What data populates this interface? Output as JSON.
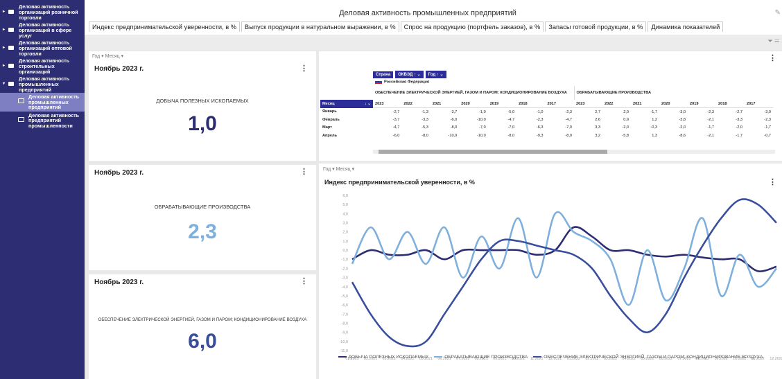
{
  "sidebar": {
    "items": [
      {
        "label": "Деловая активность организаций розничной торговли",
        "expanded": false
      },
      {
        "label": "Деловая активность организаций в сфере услуг",
        "expanded": false
      },
      {
        "label": "Деловая активность организаций оптовой торговли",
        "expanded": false
      },
      {
        "label": "Деловая активность строительных организаций",
        "expanded": false
      },
      {
        "label": "Деловая активность промышленных предприятий",
        "expanded": true
      }
    ],
    "children": [
      {
        "label": "Деловая активность промышленных предприятий",
        "active": true
      },
      {
        "label": "Деловая активность предприятий промышленности",
        "active": false
      }
    ]
  },
  "header": {
    "title": "Деловая активность промышленных предприятий",
    "tabs": [
      "Индекс предпринимательской уверенности, в %",
      "Выпуск продукции в натуральном выражении, в %",
      "Спрос на продукцию (портфель заказов), в %",
      "Запасы готовой продукции, в %",
      "Динамика показателей"
    ]
  },
  "filter_bar": {
    "year": "Год",
    "month": "Месяц"
  },
  "kpis": [
    {
      "period": "Ноябрь 2023 г.",
      "label": "ДОБЫЧА ПОЛЕЗНЫХ ИСКОПАЕМЫХ",
      "value": "1,0",
      "color": "#2d2d73"
    },
    {
      "period": "Ноябрь 2023 г.",
      "label": "ОБРАБАТЫВАЮЩИЕ ПРОИЗВОДСТВА",
      "value": "2,3",
      "color": "#7fb0dd"
    },
    {
      "period": "Ноябрь 2023 г.",
      "label": "ОБЕСПЕЧЕНИЕ ЭЛЕКТРИЧЕСКОЙ ЭНЕРГИЕЙ, ГАЗОМ И ПАРОМ; КОНДИЦИОНИРОВАНИЕ ВОЗДУХА",
      "value": "6,0",
      "color": "#3a4f9c"
    }
  ],
  "pivot": {
    "buttons": [
      "Страна",
      "ОКВЭД ↑",
      "Год ↑"
    ],
    "country": "Российская Федерация",
    "groups": [
      "ОБЕСПЕЧЕНИЕ ЭЛЕКТРИЧЕСКОЙ ЭНЕРГИЕЙ, ГАЗОМ И ПАРОМ; КОНДИЦИОНИРОВАНИЕ ВОЗДУХА",
      "ОБРАБАТЫВАЮЩИЕ ПРОИЗВОДСТВА"
    ],
    "row_header": "Месяц",
    "years": [
      "2023",
      "2022",
      "2021",
      "2020",
      "2019",
      "2018",
      "2017"
    ],
    "rows": [
      {
        "month": "Январь",
        "a": [
          "-2,7",
          "-1,3",
          "-3,7",
          "-1,0",
          "-5,0",
          "-1,0",
          "-2,3"
        ],
        "b": [
          "2,7",
          "2,0",
          "-1,7",
          "-3,0",
          "-2,3",
          "-2,7",
          "-3,0"
        ]
      },
      {
        "month": "Февраль",
        "a": [
          "-3,7",
          "-3,3",
          "-6,0",
          "-10,0",
          "-4,7",
          "-2,3",
          "-4,7"
        ],
        "b": [
          "2,6",
          "0,9",
          "1,2",
          "-3,8",
          "-2,1",
          "-3,3",
          "-2,3"
        ]
      },
      {
        "month": "Март",
        "a": [
          "-4,7",
          "-5,3",
          "-8,0",
          "-7,0",
          "-7,0",
          "-6,3",
          "-7,0"
        ],
        "b": [
          "3,3",
          "-2,0",
          "-0,3",
          "-2,0",
          "-1,7",
          "-2,0",
          "-1,7"
        ]
      },
      {
        "month": "Апрель",
        "a": [
          "-6,0",
          "-8,0",
          "-10,0",
          "-10,0",
          "-8,0",
          "-9,3",
          "-8,0"
        ],
        "b": [
          "3,2",
          "-5,8",
          "1,3",
          "-8,6",
          "-2,1",
          "-1,7",
          "-0,7"
        ]
      }
    ]
  },
  "chart_data": {
    "type": "line",
    "title": "Индекс предпринимательской уверенности, в %",
    "ylim": [
      -11,
      6
    ],
    "yticks": [
      "6,0",
      "5,0",
      "4,0",
      "3,0",
      "2,0",
      "1,0",
      "0,0",
      "-1,0",
      "-2,0",
      "-3,0",
      "-4,0",
      "-5,0",
      "-6,0",
      "-7,0",
      "-8,0",
      "-9,0",
      "-10,0",
      "-11,0"
    ],
    "x": [
      "01.2021",
      "02.2021",
      "03.2021",
      "04.2021",
      "05.2021",
      "06.2021",
      "07.2021",
      "08.2021",
      "09.2021",
      "10.2021",
      "11.2021",
      "12.2021",
      "01.2022",
      "02.2022",
      "03.2022",
      "04.2022",
      "05.2022",
      "06.2022",
      "07.2022",
      "08.2022",
      "09.2022",
      "10.2022",
      "11.2022",
      "12.2022"
    ],
    "series": [
      {
        "name": "ДОБЫЧА ПОЛЕЗНЫХ ИСКОПАЕМЫХ",
        "color": "#2d2d73",
        "values": [
          -1.0,
          0.0,
          -0.5,
          -0.5,
          0.0,
          -1.0,
          0.0,
          0.0,
          0.0,
          0.0,
          -0.5,
          0.0,
          2.5,
          1.5,
          0.0,
          0.0,
          -0.5,
          -0.7,
          -0.5,
          -0.8,
          -1.0,
          -1.0,
          -2.3,
          -1.8
        ]
      },
      {
        "name": "ОБРАБАТЫВАЮЩИЕ ПРОИЗВОДСТВА",
        "color": "#7fb0dd",
        "values": [
          -1.5,
          2.5,
          -1.0,
          2.0,
          -1.5,
          2.5,
          -3.0,
          1.5,
          -2.0,
          3.5,
          -3.0,
          4.0,
          2.0,
          1.0,
          -1.0,
          -6.0,
          0.0,
          -5.5,
          -2.0,
          3.5,
          -5.0,
          -0.5,
          -4.0,
          -2.0
        ]
      },
      {
        "name": "ОБЕСПЕЧЕНИЕ ЭЛЕКТРИЧЕСКОЙ ЭНЕРГИЕЙ, ГАЗОМ И ПАРОМ; КОНДИЦИОНИРОВАНИЕ ВОЗДУХА",
        "color": "#3a4f9c",
        "values": [
          -3.5,
          -7.0,
          -9.5,
          -10.5,
          -10.0,
          -7.0,
          -4.0,
          -1.0,
          1.0,
          1.0,
          0.5,
          0.0,
          -0.5,
          -2.0,
          -5.0,
          -7.5,
          -9.0,
          -7.0,
          -3.0,
          0.5,
          3.5,
          5.5,
          5.0,
          3.0
        ]
      }
    ]
  }
}
